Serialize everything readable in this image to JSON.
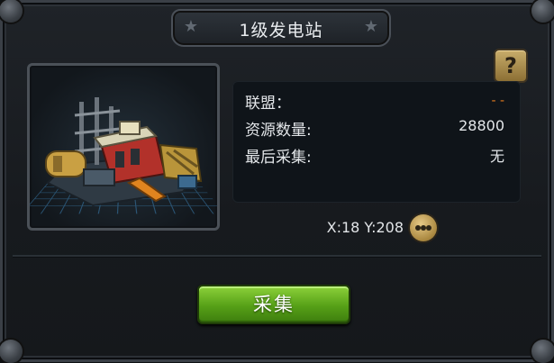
{
  "dialog": {
    "title": "1级发电站"
  },
  "info": {
    "alliance_label": "联盟：",
    "alliance_value": "- -",
    "resource_label": "资源数量:",
    "resource_value": "28800",
    "last_collect_label": "最后采集:",
    "last_collect_value": "无"
  },
  "location": {
    "coords_text": "X:18 Y:208"
  },
  "buttons": {
    "help_glyph": "?",
    "collect_label": "采集"
  },
  "colors": {
    "accent_green": "#56a017",
    "alliance_value_color": "#e07a1f",
    "gold_button": "#c8ad6b"
  },
  "icons": {
    "help": "question-mark-icon",
    "more": "more-dots-icon",
    "title_decoration": "star-icon",
    "building": "power-station-image"
  }
}
